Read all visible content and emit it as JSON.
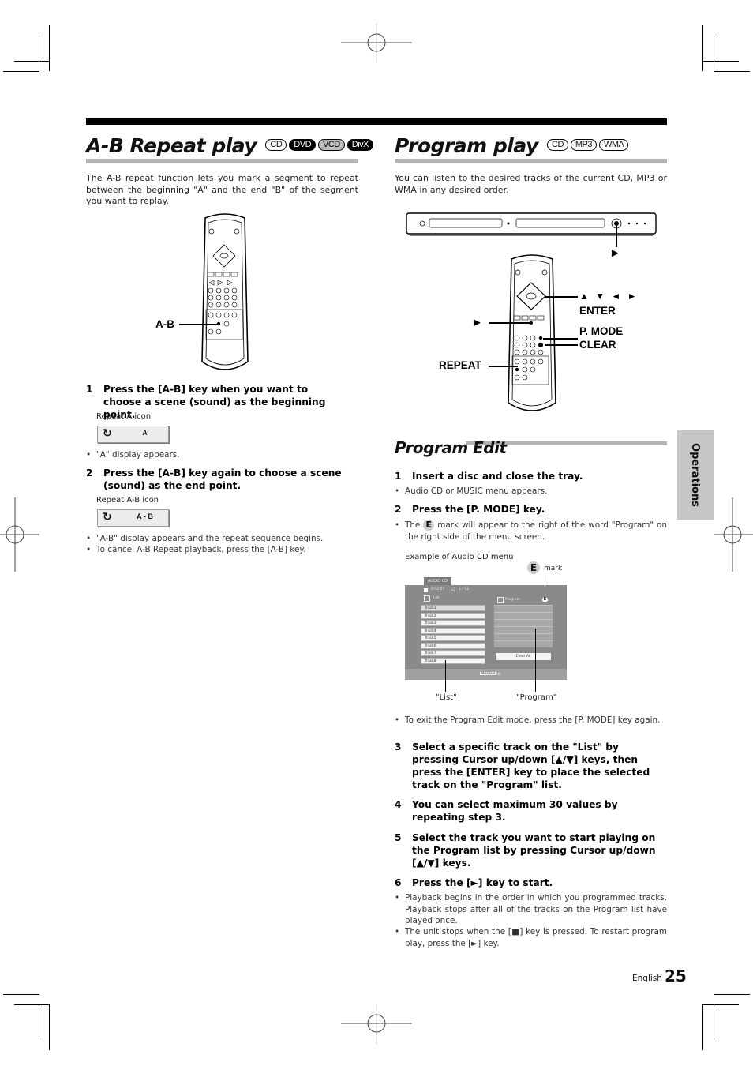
{
  "left_section": {
    "title": "A-B Repeat play",
    "disc_badges": [
      {
        "label": "CD",
        "style": "outline"
      },
      {
        "label": "DVD",
        "style": "filled"
      },
      {
        "label": "VCD",
        "style": "gray"
      },
      {
        "label": "DivX",
        "style": "filled"
      }
    ],
    "intro": "The A-B repeat function lets you mark a segment to repeat between the beginning \"A\" and the end \"B\" of the segment you want to replay.",
    "remote_callout": "A-B",
    "steps": [
      {
        "num": "1",
        "text": "Press the [A-B] key when you want to choose a scene (sound) as the beginning point.",
        "caption": "Repeat A icon",
        "icon_label": "A",
        "bullets": [
          "\"A\" display appears."
        ]
      },
      {
        "num": "2",
        "text": "Press the [A-B] key again to choose a scene (sound) as the end point.",
        "caption": "Repeat A-B icon",
        "icon_label": "A - B",
        "bullets": [
          "\"A-B\" display appears and the repeat sequence begins.",
          "To cancel A-B Repeat playback, press the [A-B] key."
        ]
      }
    ]
  },
  "right_section": {
    "title": "Program play",
    "disc_badges": [
      {
        "label": "CD",
        "style": "outline"
      },
      {
        "label": "MP3",
        "style": "outline"
      },
      {
        "label": "WMA",
        "style": "outline"
      }
    ],
    "intro": "You can listen to the desired tracks of the current CD, MP3 or WMA in any desired order.",
    "callouts": {
      "play_unit": "►",
      "cursor": "▲ ▼ ◄ ►",
      "enter": "ENTER",
      "play_remote": "►",
      "pmode": "P. MODE",
      "clear": "CLEAR",
      "repeat": "REPEAT"
    },
    "subsection_title": "Program Edit",
    "step1": {
      "num": "1",
      "text": "Insert a disc and close the tray.",
      "bullet": "Audio CD or MUSIC menu appears."
    },
    "step2": {
      "num": "2",
      "text": "Press the [P. MODE] key.",
      "bullet_pre": "The",
      "bullet_mark": "E",
      "bullet_post": "mark will appear to the right of the word \"Program\" on the right side of the menu screen."
    },
    "menu_example": {
      "caption": "Example of Audio CD menu",
      "e_mark": "E",
      "e_mark_label": "mark",
      "tab": "AUDIO CD",
      "time": "0:52:07",
      "track_count": "1 / 12",
      "list_header": "List",
      "program_header": "Program",
      "tracks": [
        "Track1",
        "Track2",
        "Track3",
        "Track4",
        "Track5",
        "Track6",
        "Track7",
        "Track8"
      ],
      "clear_all": "Clear All",
      "footer_key": "PROGRAM",
      "footer_text": "Edit",
      "label_list": "\"List\"",
      "label_program": "\"Program\""
    },
    "exit_note": "To exit the Program Edit mode, press the [P. MODE] key again.",
    "steps": [
      {
        "num": "3",
        "text": "Select a specific track on the \"List\" by pressing Cursor up/down [▲/▼] keys, then press the [ENTER] key to place the selected track on the \"Program\" list."
      },
      {
        "num": "4",
        "text": "You can select maximum 30 values by repeating step 3."
      },
      {
        "num": "5",
        "text": "Select the track you want to start playing on the Program list by pressing Cursor up/down [▲/▼] keys."
      },
      {
        "num": "6",
        "text": "Press the [►] key to start."
      }
    ],
    "final_bullets": [
      "Playback begins in the order in which you programmed tracks. Playback stops after all of the tracks on the Program list have played once.",
      "The unit stops when the [■] key is pressed. To restart program play, press the [►] key."
    ]
  },
  "side_tab": "Operations",
  "footer": {
    "language": "English",
    "page": "25"
  }
}
